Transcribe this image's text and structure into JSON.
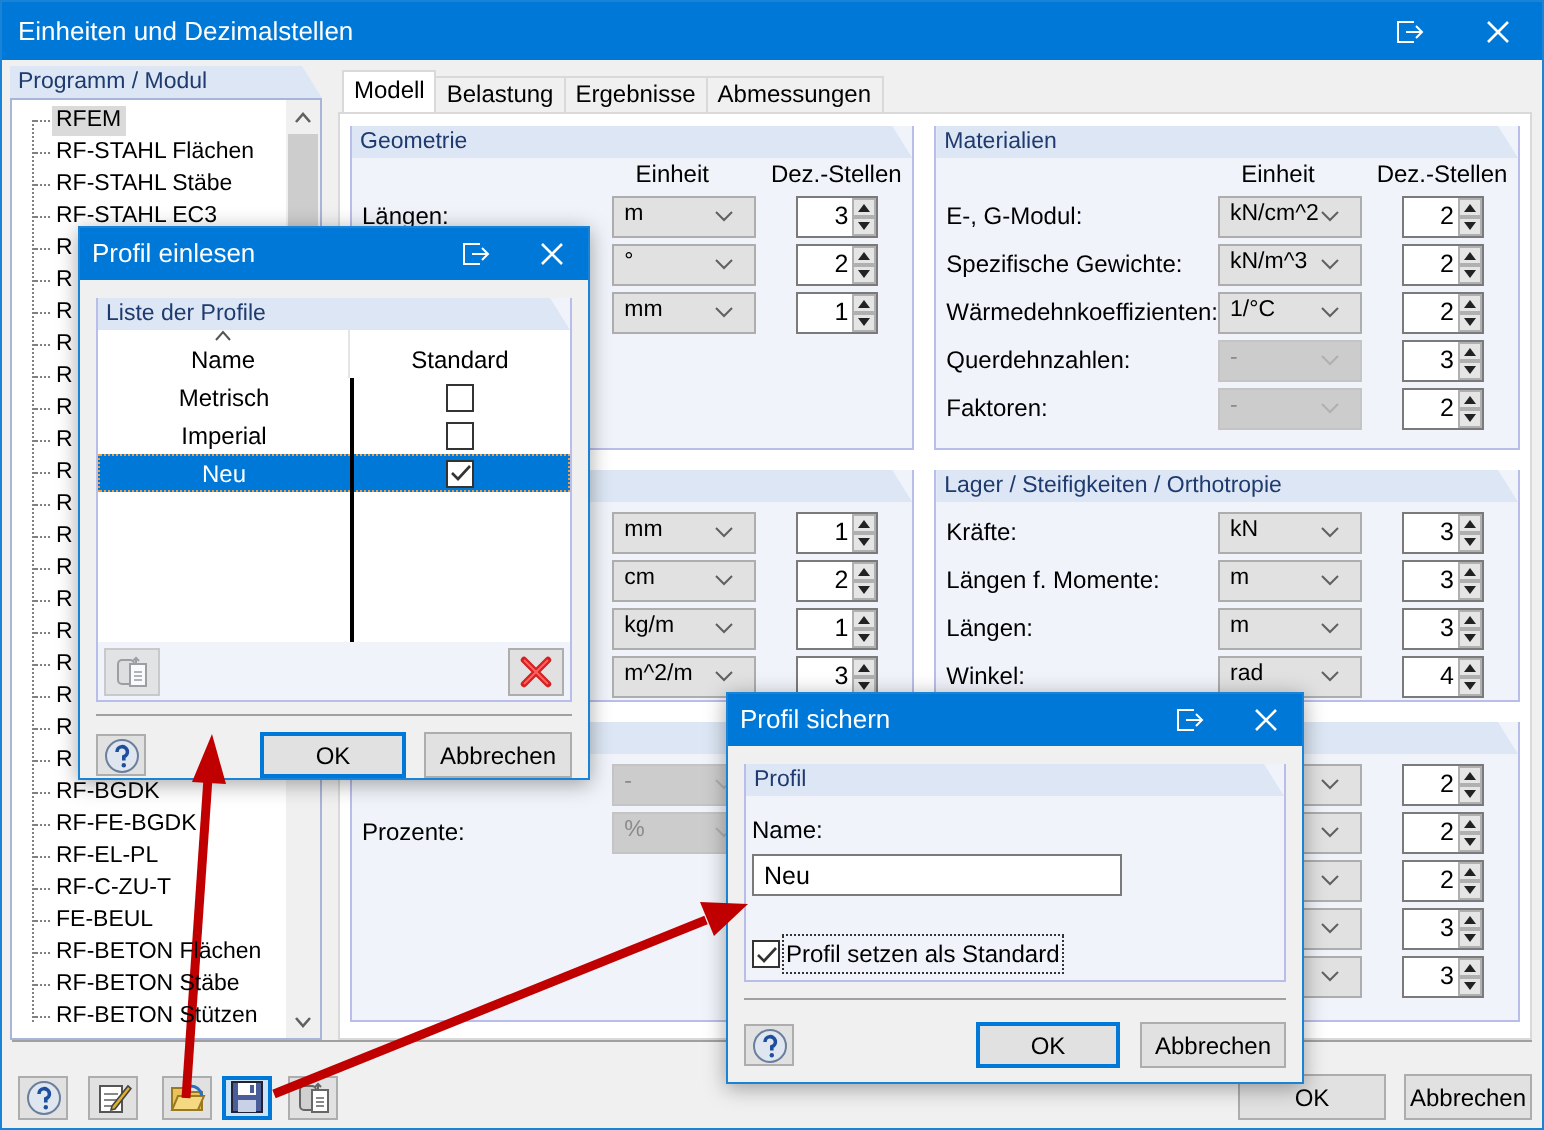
{
  "window": {
    "title": "Einheiten und Dezimalstellen"
  },
  "sidebar": {
    "title": "Programm / Modul",
    "items": [
      {
        "label": "RFEM",
        "selected": true
      },
      {
        "label": "RF-STAHL Flächen",
        "selected": false
      },
      {
        "label": "RF-STAHL Stäbe",
        "selected": false
      },
      {
        "label": "RF-STAHL EC3",
        "selected": false
      },
      {
        "label": "R",
        "selected": false
      },
      {
        "label": "R",
        "selected": false
      },
      {
        "label": "R",
        "selected": false
      },
      {
        "label": "R",
        "selected": false
      },
      {
        "label": "R",
        "selected": false
      },
      {
        "label": "R",
        "selected": false
      },
      {
        "label": "R",
        "selected": false
      },
      {
        "label": "R",
        "selected": false
      },
      {
        "label": "R",
        "selected": false
      },
      {
        "label": "R",
        "selected": false
      },
      {
        "label": "R",
        "selected": false
      },
      {
        "label": "R",
        "selected": false
      },
      {
        "label": "R",
        "selected": false
      },
      {
        "label": "R",
        "selected": false
      },
      {
        "label": "R",
        "selected": false
      },
      {
        "label": "R",
        "selected": false
      },
      {
        "label": "R",
        "selected": false
      },
      {
        "label": "RF-BGDK",
        "selected": false
      },
      {
        "label": "RF-FE-BGDK",
        "selected": false
      },
      {
        "label": "RF-EL-PL",
        "selected": false
      },
      {
        "label": "RF-C-ZU-T",
        "selected": false
      },
      {
        "label": "FE-BEUL",
        "selected": false
      },
      {
        "label": "RF-BETON Flächen",
        "selected": false
      },
      {
        "label": "RF-BETON Stäbe",
        "selected": false
      },
      {
        "label": "RF-BETON Stützen",
        "selected": false
      }
    ]
  },
  "tabs": [
    {
      "label": "Modell",
      "selected": true
    },
    {
      "label": "Belastung",
      "selected": false
    },
    {
      "label": "Ergebnisse",
      "selected": false
    },
    {
      "label": "Abmessungen",
      "selected": false
    }
  ],
  "panels": [
    {
      "title": "Geometrie",
      "headers": [
        "Einheit",
        "Dez.-Stellen"
      ],
      "rows": [
        {
          "label": "Längen:",
          "unit": "m",
          "disabled": false,
          "decimals": "3"
        },
        {
          "unit": "°",
          "disabled": false,
          "decimals": "2"
        },
        {
          "unit": "mm",
          "disabled": false,
          "decimals": "1"
        }
      ]
    },
    {
      "title": "Materialien",
      "headers": [
        "Einheit",
        "Dez.-Stellen"
      ],
      "rows": [
        {
          "label": "E-, G-Modul:",
          "unit": "kN/cm^2",
          "disabled": false,
          "decimals": "2"
        },
        {
          "label": "Spezifische Gewichte:",
          "unit": "kN/m^3",
          "disabled": false,
          "decimals": "2"
        },
        {
          "label": "Wärmedehnkoeffizienten:",
          "unit": "1/°C",
          "disabled": false,
          "decimals": "2"
        },
        {
          "label": "Querdehnzahlen:",
          "unit": "-",
          "disabled": true,
          "decimals": "3"
        },
        {
          "label": "Faktoren:",
          "unit": "-",
          "disabled": true,
          "decimals": "2"
        }
      ]
    },
    {
      "rows": [
        {
          "unit": "mm",
          "disabled": false,
          "decimals": "1"
        },
        {
          "unit": "cm",
          "disabled": false,
          "decimals": "2"
        },
        {
          "unit": "kg/m",
          "disabled": false,
          "decimals": "1"
        },
        {
          "unit": "m^2/m",
          "disabled": false,
          "decimals": "3"
        }
      ]
    },
    {
      "title": "Lager / Steifigkeiten / Orthotropie",
      "rows": [
        {
          "label": "Kräfte:",
          "unit": "kN",
          "disabled": false,
          "decimals": "3"
        },
        {
          "label": "Längen f. Momente:",
          "unit": "m",
          "disabled": false,
          "decimals": "3"
        },
        {
          "label": "Längen:",
          "unit": "m",
          "disabled": false,
          "decimals": "3"
        },
        {
          "label": "Winkel:",
          "unit": "rad",
          "disabled": false,
          "decimals": "4"
        }
      ]
    },
    {
      "rows": [
        {
          "unit": "-",
          "disabled": true
        },
        {
          "label": "Prozente:",
          "unit": "%",
          "disabled": true
        }
      ]
    },
    {
      "rows": [
        {
          "disabled": false,
          "decimals": "2"
        },
        {
          "disabled": false,
          "decimals": "2"
        },
        {
          "disabled": false,
          "decimals": "2"
        },
        {
          "disabled": false,
          "decimals": "3"
        },
        {
          "disabled": false,
          "decimals": "3"
        }
      ]
    }
  ],
  "footer": {
    "tools": [
      {
        "kind": "help",
        "focused": false
      },
      {
        "kind": "edit",
        "focused": false
      },
      {
        "kind": "open",
        "focused": false
      },
      {
        "kind": "save",
        "focused": true
      },
      {
        "kind": "import",
        "focused": false
      }
    ],
    "buttons": [
      {
        "label": "OK",
        "focused": false
      },
      {
        "label": "Abbrechen",
        "focused": false
      }
    ]
  },
  "profile_list_dialog": {
    "title": "Profil einlesen",
    "group": "Liste der Profile",
    "columns": [
      "Name",
      "Standard"
    ],
    "rows": [
      {
        "name": "Metrisch",
        "checked": false,
        "selected": false
      },
      {
        "name": "Imperial",
        "checked": false,
        "selected": false
      },
      {
        "name": "Neu",
        "checked": true,
        "selected": true
      }
    ],
    "tools": [
      {
        "kind": "import",
        "disabled": true
      },
      {
        "kind": "delete",
        "disabled": false
      }
    ],
    "buttons": [
      {
        "label": "OK",
        "focused": true
      },
      {
        "label": "Abbrechen",
        "focused": false
      }
    ]
  },
  "profile_save_dialog": {
    "title": "Profil sichern",
    "group": "Profil",
    "field_label": "Name:",
    "field_value": "Neu",
    "checkbox": {
      "label": "Profil setzen als Standard",
      "checked": true
    },
    "buttons": [
      {
        "label": "OK",
        "focused": true
      },
      {
        "label": "Abbrechen",
        "focused": false
      }
    ]
  }
}
